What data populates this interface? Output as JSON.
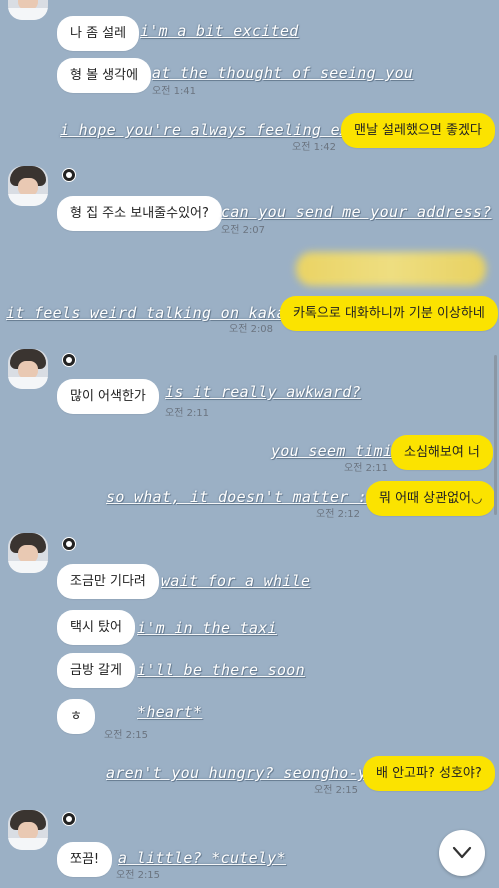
{
  "messages": [
    {
      "kr": "나 좀 설레",
      "en": "i'm a bit excited",
      "time": ""
    },
    {
      "kr": "형 볼 생각에",
      "en": "at the thought of seeing you",
      "time": "오전 1:41"
    },
    {
      "kr": "맨날 설레했으면 좋겠다",
      "en": "i hope you're always feeling excited",
      "time": "오전 1:42"
    },
    {
      "kr": "형 집 주소 보내줄수있어?",
      "en": "can you send me your address?",
      "time": "오전 2:07"
    },
    {
      "kr": "카톡으로 대화하니까 기분 이상하네",
      "en": "it feels weird talking  on kakaotalk",
      "time": "오전 2:08"
    },
    {
      "kr": "많이 어색한가",
      "en": "is it really awkward?",
      "time": "오전 2:11"
    },
    {
      "kr": "소심해보여 너",
      "en": "you seem timid",
      "time": "오전 2:11"
    },
    {
      "kr": "뭐 어때 상관없어◡",
      "en": "so what, it doesn't matter :)",
      "time": "오전 2:12"
    },
    {
      "kr": "조금만 기다려",
      "en": "wait for a while",
      "time": ""
    },
    {
      "kr": "택시 탔어",
      "en": "i'm in the taxi",
      "time": ""
    },
    {
      "kr": "금방 갈게",
      "en": "i'll be there soon",
      "time": ""
    },
    {
      "kr": "ㅎ",
      "en": "*heart*",
      "time": "오전 2:15"
    },
    {
      "kr": "배 안고파? 성호야?",
      "en": "aren't you hungry? seongho-ya?",
      "time": "오전 2:15"
    },
    {
      "kr": "쪼끔!",
      "en": "a little? *cutely*",
      "time": "오전 2:15"
    }
  ],
  "colors": {
    "background": "#9bb0c5",
    "incoming": "#ffffff",
    "outgoing": "#fbe300"
  },
  "icons": {
    "scroll_down": "chevron-down-icon"
  }
}
